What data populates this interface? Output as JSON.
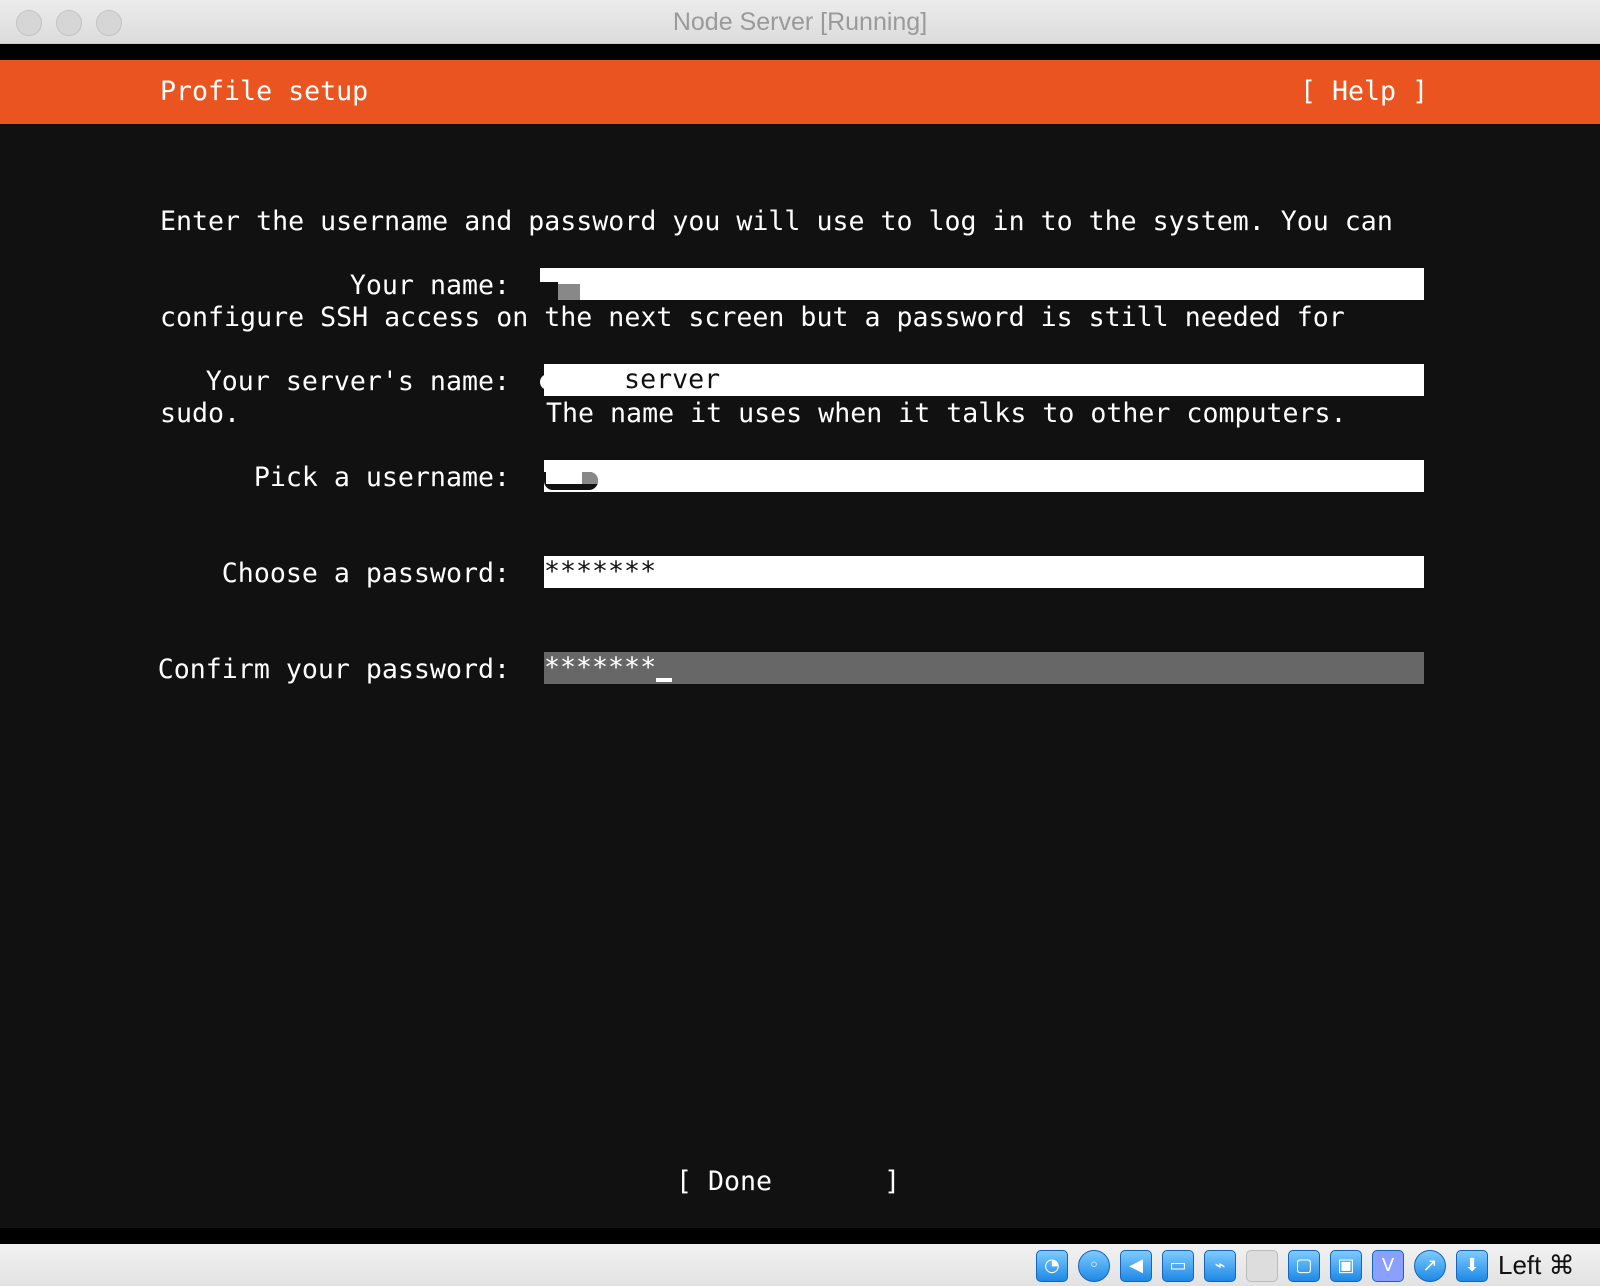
{
  "window": {
    "title": "Node Server [Running]"
  },
  "header": {
    "title": "Profile setup",
    "help": "[ Help ]"
  },
  "intro": {
    "lines": [
      "Enter the username and password you will use to log in to the system. You can",
      "configure SSH access on the next screen but a password is still needed for",
      "sudo."
    ]
  },
  "form": {
    "name": {
      "label": "Your name:",
      "value": ""
    },
    "server": {
      "label": "Your server's name:",
      "value": "     server",
      "hint": "The name it uses when it talks to other computers."
    },
    "username": {
      "label": "Pick a username:",
      "value": ""
    },
    "password": {
      "label": "Choose a password:",
      "value": "*******"
    },
    "confirm": {
      "label": "Confirm your password:",
      "value": "*******"
    }
  },
  "footer": {
    "done": "[ Done       ]"
  },
  "statusbar": {
    "icons": [
      "hard-disk-icon",
      "optical-drive-icon",
      "audio-icon",
      "network-icon",
      "usb-icon",
      "shared-folder-icon",
      "display-icon",
      "video-capture-icon",
      "cpu-icon",
      "mouse-integration-icon",
      "keyboard-icon"
    ],
    "host_key": "Left ⌘",
    "accent": "#e95420"
  }
}
